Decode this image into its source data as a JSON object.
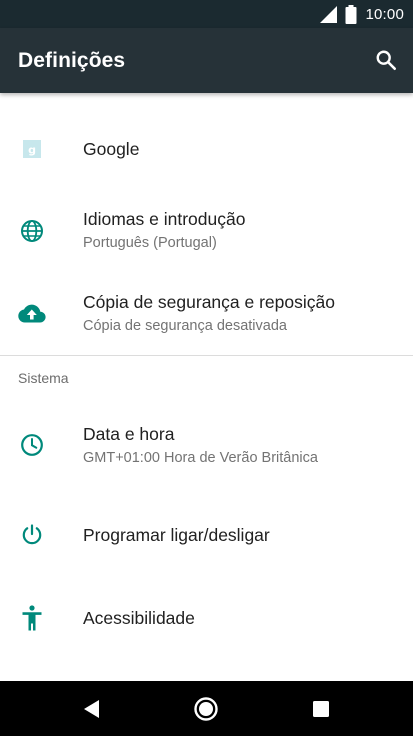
{
  "status_bar": {
    "time": "10:00",
    "icons": [
      "signal-icon",
      "battery-icon"
    ]
  },
  "app_bar": {
    "title": "Definições",
    "search_icon": "search-icon"
  },
  "settings": {
    "items": [
      {
        "title": "Google",
        "icon": "google-icon",
        "icon_color": "#bfe3e8"
      },
      {
        "title": "Idiomas e introdução",
        "subtitle": "Português (Portugal)",
        "icon": "globe-icon",
        "icon_color": "#00897b"
      },
      {
        "title": "Cópia de segurança e reposição",
        "subtitle": "Cópia de segurança desativada",
        "icon": "cloud-upload-icon",
        "icon_color": "#00897b"
      }
    ],
    "section_header": "Sistema",
    "system_items": [
      {
        "title": "Data e hora",
        "subtitle": "GMT+01:00 Hora de Verão Britânica",
        "icon": "clock-icon",
        "icon_color": "#00897b"
      },
      {
        "title": "Programar ligar/desligar",
        "icon": "power-icon",
        "icon_color": "#00897b"
      },
      {
        "title": "Acessibilidade",
        "icon": "accessibility-icon",
        "icon_color": "#00897b"
      }
    ]
  },
  "nav_bar": {
    "icons": [
      "back-icon",
      "home-icon",
      "recents-icon"
    ]
  }
}
